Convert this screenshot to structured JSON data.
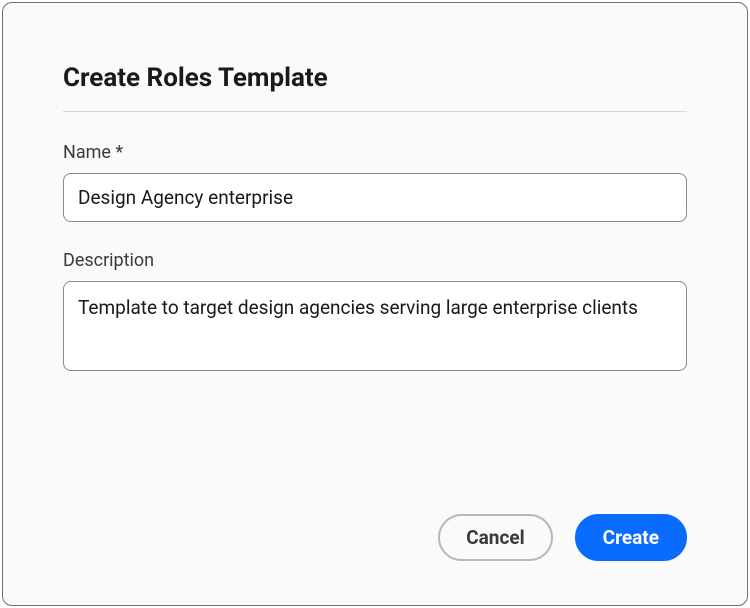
{
  "dialog": {
    "title": "Create Roles Template"
  },
  "fields": {
    "name": {
      "label": "Name *",
      "value": "Design Agency enterprise"
    },
    "description": {
      "label": "Description",
      "value": "Template to target design agencies serving large enterprise clients"
    }
  },
  "buttons": {
    "cancel": "Cancel",
    "create": "Create"
  }
}
